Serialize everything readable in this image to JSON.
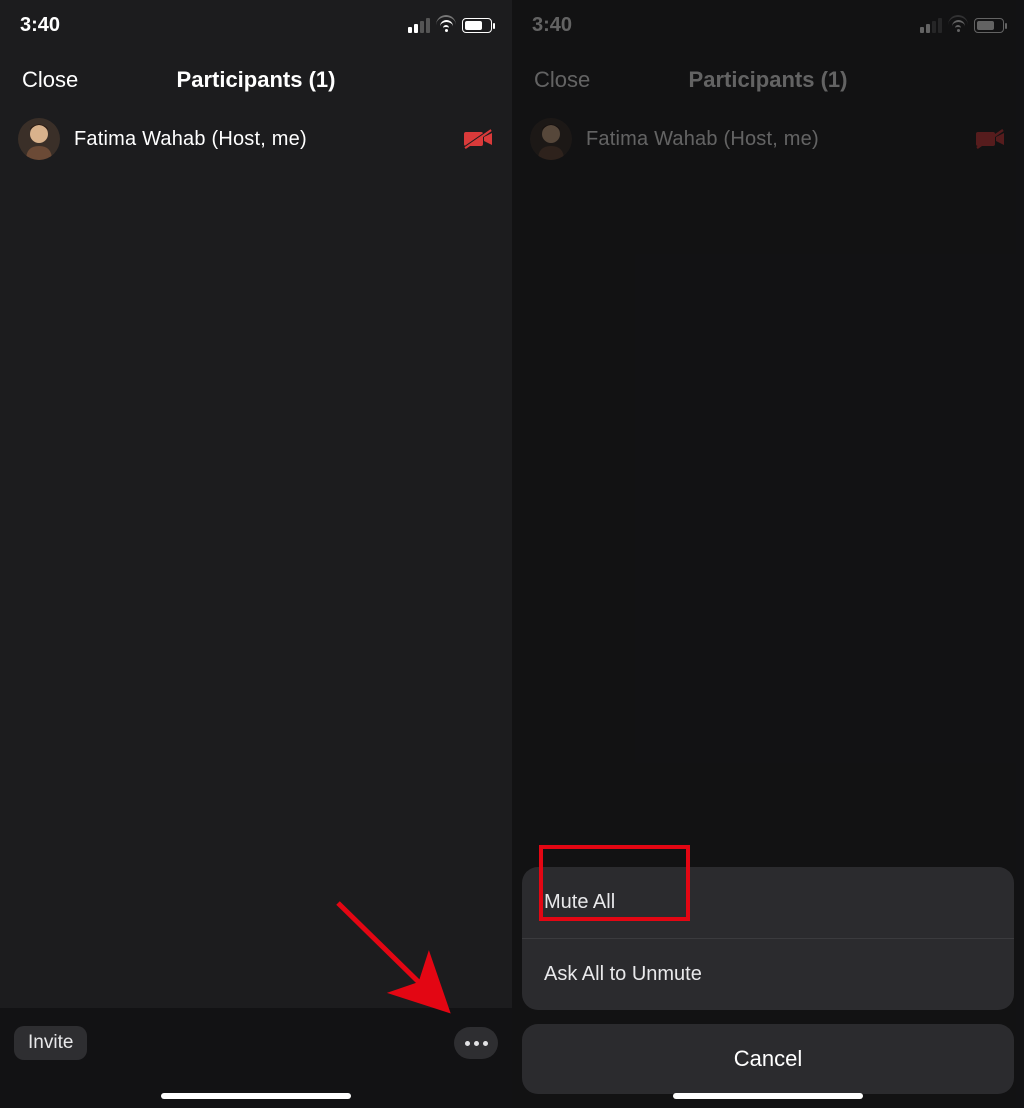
{
  "status": {
    "time": "3:40"
  },
  "nav": {
    "close": "Close",
    "title": "Participants (1)"
  },
  "participant": {
    "name": "Fatima Wahab (Host, me)"
  },
  "bottom": {
    "invite": "Invite"
  },
  "sheet": {
    "mute_all": "Mute All",
    "ask_unmute": "Ask All to Unmute",
    "cancel": "Cancel"
  }
}
